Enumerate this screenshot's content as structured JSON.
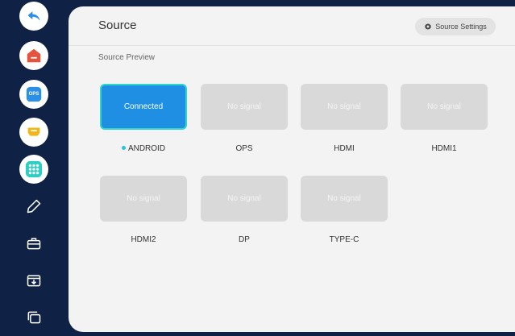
{
  "colors": {
    "background": "#0f2145",
    "panel": "#f3f3f3",
    "active_tile": "#1f8fe3",
    "active_border": "#2fd6c8",
    "idle_tile": "#d9d9d9",
    "status_dot": "#26c6da"
  },
  "sidebar": {
    "items": [
      {
        "icon": "back-arrow-icon"
      },
      {
        "icon": "home-icon"
      },
      {
        "icon": "ops-icon",
        "label": "OPS"
      },
      {
        "icon": "hdmi-icon"
      },
      {
        "icon": "apps-grid-icon"
      },
      {
        "icon": "pen-icon"
      },
      {
        "icon": "toolbox-icon"
      },
      {
        "icon": "download-icon"
      },
      {
        "icon": "windows-icon"
      }
    ]
  },
  "header": {
    "title": "Source",
    "settings_label": "Source Settings",
    "settings_icon": "gear-icon"
  },
  "preview": {
    "label": "Source Preview",
    "sources": [
      {
        "name": "ANDROID",
        "status": "Connected",
        "active": true
      },
      {
        "name": "OPS",
        "status": "No signal",
        "active": false
      },
      {
        "name": "HDMI",
        "status": "No signal",
        "active": false
      },
      {
        "name": "HDMI1",
        "status": "No signal",
        "active": false
      },
      {
        "name": "HDMI2",
        "status": "No signal",
        "active": false
      },
      {
        "name": "DP",
        "status": "No signal",
        "active": false
      },
      {
        "name": "TYPE-C",
        "status": "No signal",
        "active": false
      }
    ]
  }
}
